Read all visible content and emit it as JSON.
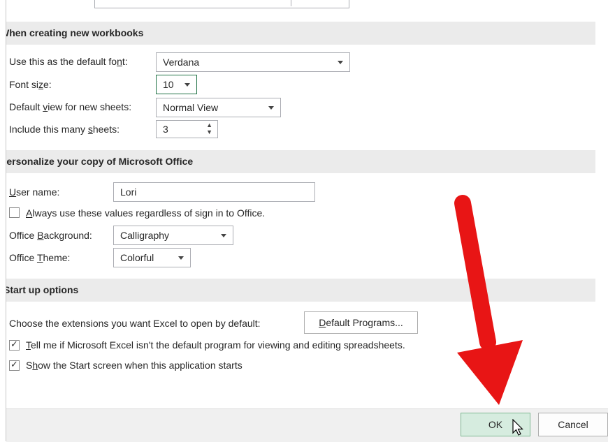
{
  "new_workbooks": {
    "heading": "When creating new workbooks",
    "default_font": {
      "label_pre": "Use this as the default fo",
      "label_u": "n",
      "label_post": "t:",
      "value": "Verdana"
    },
    "font_size": {
      "label_pre": "Font si",
      "label_u": "z",
      "label_post": "e:",
      "value": "10"
    },
    "default_view": {
      "label_pre": "Default ",
      "label_u": "v",
      "label_post": "iew for new sheets:",
      "value": "Normal View"
    },
    "sheets": {
      "label_pre": "Include this many ",
      "label_u": "s",
      "label_post": "heets:",
      "value": "3"
    }
  },
  "personalize": {
    "heading": "Personalize your copy of Microsoft Office",
    "user_name": {
      "label_pre": "",
      "label_u": "U",
      "label_post": "ser name:",
      "value": "Lori"
    },
    "always_use": {
      "label_pre": "",
      "label_u": "A",
      "label_post": "lways use these values regardless of sign in to Office.",
      "checked": false
    },
    "background": {
      "label_pre": "Office ",
      "label_u": "B",
      "label_post": "ackground:",
      "value": "Calligraphy"
    },
    "theme": {
      "label_pre": "Office ",
      "label_u": "T",
      "label_post": "heme:",
      "value": "Colorful"
    }
  },
  "startup": {
    "heading": "Start up options",
    "extensions_label": "Choose the extensions you want Excel to open by default:",
    "default_programs": {
      "label_pre": "",
      "label_u": "D",
      "label_post": "efault Programs..."
    },
    "tell_me": {
      "label_pre": "",
      "label_u": "T",
      "label_post": "ell me if Microsoft Excel isn't the default program for viewing and editing spreadsheets.",
      "checked": true
    },
    "show_start": {
      "label_pre": "S",
      "label_u": "h",
      "label_post": "ow the Start screen when this application starts",
      "checked": true
    }
  },
  "footer": {
    "ok_label": "OK",
    "cancel_label": "Cancel"
  },
  "colors": {
    "arrow": "#e81515",
    "ok_bg": "#d6ecdf",
    "section_bg": "#ebebeb",
    "focus_border": "#217346"
  }
}
